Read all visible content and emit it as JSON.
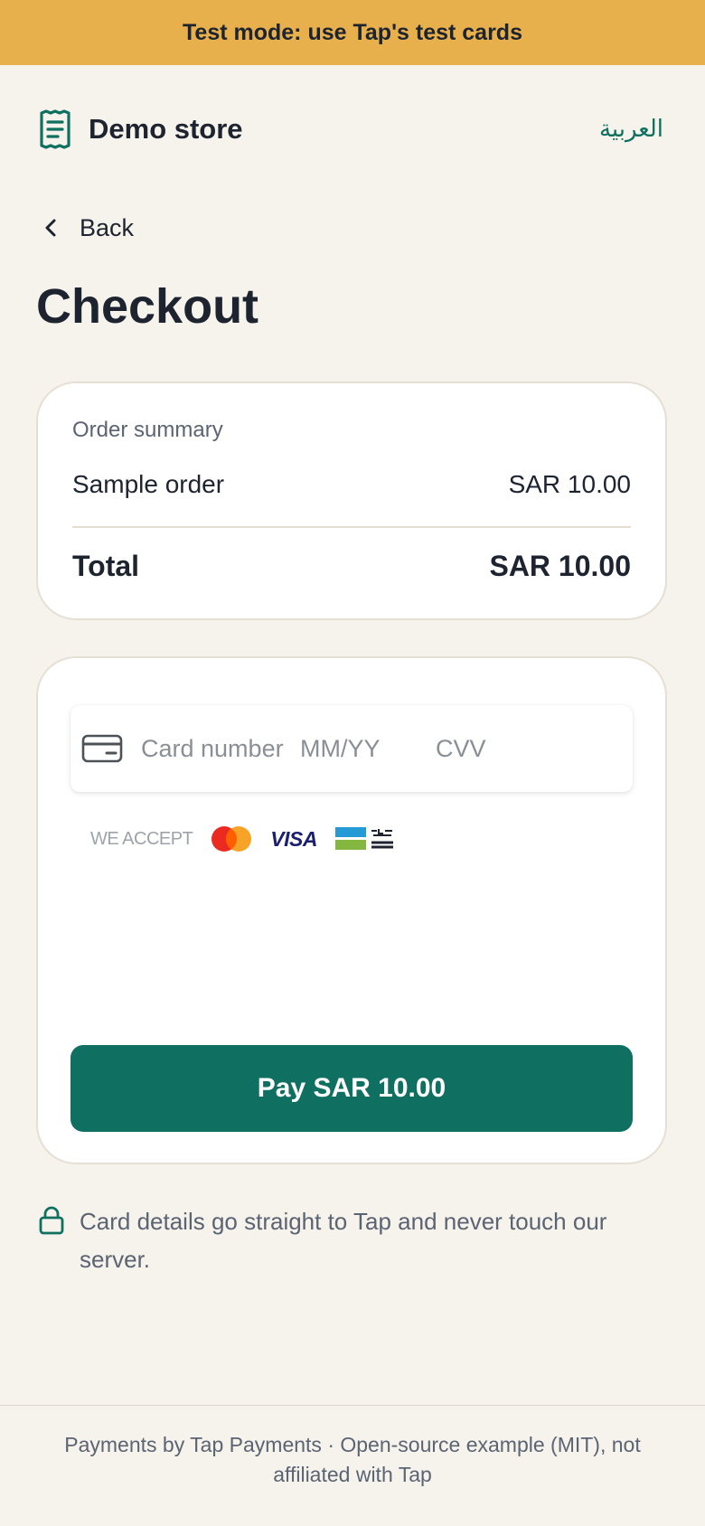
{
  "banner": {
    "text": "Test mode: use Tap's test cards"
  },
  "header": {
    "store_name": "Demo store",
    "language_link": "العربية"
  },
  "nav": {
    "back_label": "Back"
  },
  "page": {
    "title": "Checkout"
  },
  "summary": {
    "label": "Order summary",
    "item_name": "Sample order",
    "item_price": "SAR 10.00",
    "total_label": "Total",
    "total_value": "SAR 10.00"
  },
  "payment": {
    "card_number_placeholder": "Card number",
    "expiry_placeholder": "MM/YY",
    "cvv_placeholder": "CVV",
    "accept_label": "WE ACCEPT",
    "brands": [
      "mastercard-icon",
      "VISA",
      "mada-icon"
    ],
    "pay_button": "Pay SAR 10.00"
  },
  "security_note": "Card details go straight to Tap and never touch our server.",
  "footer": {
    "text": "Payments by Tap Payments · Open-source example (MIT), not affiliated with Tap"
  },
  "colors": {
    "accent": "#0f7062",
    "banner": "#e8b04c",
    "background": "#f6f2ec"
  }
}
